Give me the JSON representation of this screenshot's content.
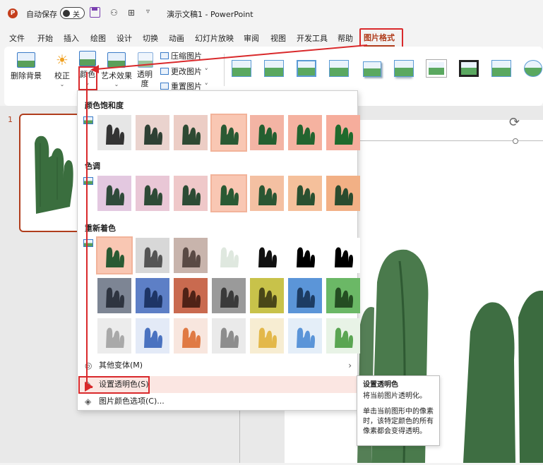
{
  "titlebar": {
    "app_icon": "P",
    "autosave_label": "自动保存",
    "autosave_state": "关",
    "doc_title": "演示文稿1 - PowerPoint",
    "icons": [
      "save-icon",
      "person-icon",
      "layout-icon",
      "customize-icon"
    ]
  },
  "tabs": [
    "文件",
    "开始",
    "插入",
    "绘图",
    "设计",
    "切换",
    "动画",
    "幻灯片放映",
    "审阅",
    "视图",
    "开发工具",
    "帮助",
    "图片格式"
  ],
  "ribbon": {
    "remove_bg": "删除背景",
    "corrections": "校正",
    "color": "颜色",
    "artistic": "艺术效果",
    "transparency": "透明度",
    "compress": "压缩图片",
    "change": "更改图片",
    "reset": "重置图片"
  },
  "slide_number": "1",
  "dropdown": {
    "saturation_title": "颜色饱和度",
    "tone_title": "色调",
    "recolor_title": "重新着色",
    "more_variations": "其他变体(M)",
    "set_transparent": "设置透明色(S)",
    "color_options": "图片颜色选项(C)..."
  },
  "tooltip": {
    "title": "设置透明色",
    "line1": "将当前图片透明化。",
    "line2": "单击当前图形中的像素时，该特定颜色的所有像素都会变得透明。"
  },
  "colors": {
    "accent": "#b03d1c",
    "annotation": "#d9292b"
  }
}
